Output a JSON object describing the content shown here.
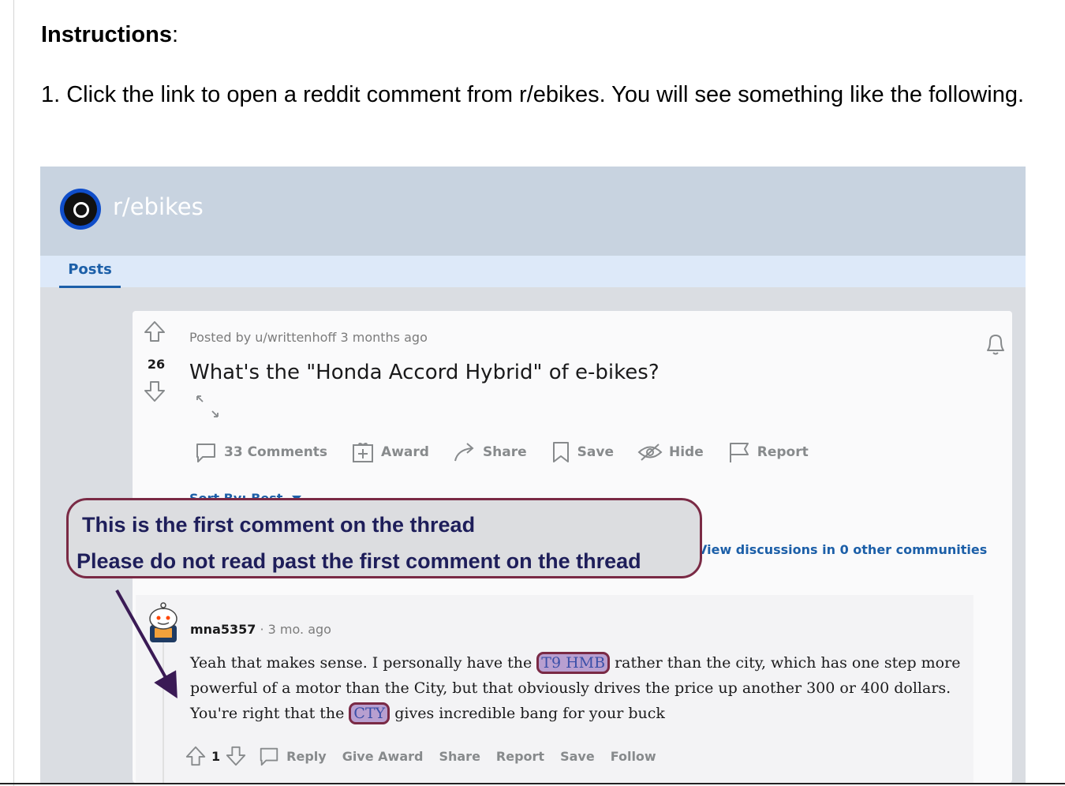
{
  "instructions": {
    "title": "Instructions",
    "colon": ":",
    "step1": "1. Click the link to open a reddit comment from r/ebikes. You will see something like the following."
  },
  "reddit": {
    "subreddit": "r/ebikes",
    "tab": "Posts",
    "post": {
      "posted_by": "Posted by u/writtenhoff 3 months ago",
      "votes": "26",
      "title": "What's the \"Honda Accord Hybrid\" of e-bikes?",
      "actions": [
        "33 Comments",
        "Award",
        "Share",
        "Save",
        "Hide",
        "Report"
      ],
      "sort": "Sort By: Best",
      "view_discussions": "View discussions in 0 other communities"
    },
    "comment": {
      "author": "mna5357",
      "age": "3 mo. ago",
      "body_pre1": "Yeah that makes sense. I personally have the ",
      "hl1": "T9 HMB",
      "body_mid": " rather than the city, which has one step more powerful of a motor than the City, but that obviously drives the price up another 300 or 400 dollars. You're right that the ",
      "hl2": "CTY",
      "body_end": " gives incredible bang for your buck",
      "votes": "1",
      "actions": [
        "Reply",
        "Give Award",
        "Share",
        "Report",
        "Save",
        "Follow"
      ]
    }
  },
  "callout": {
    "line1": "This is the first comment on the thread",
    "line2": "Please do not read past the first comment on the thread"
  },
  "colors": {
    "accent": "#7a2a45",
    "link": "#1c5fa8",
    "highlight": "#b89fd0"
  }
}
